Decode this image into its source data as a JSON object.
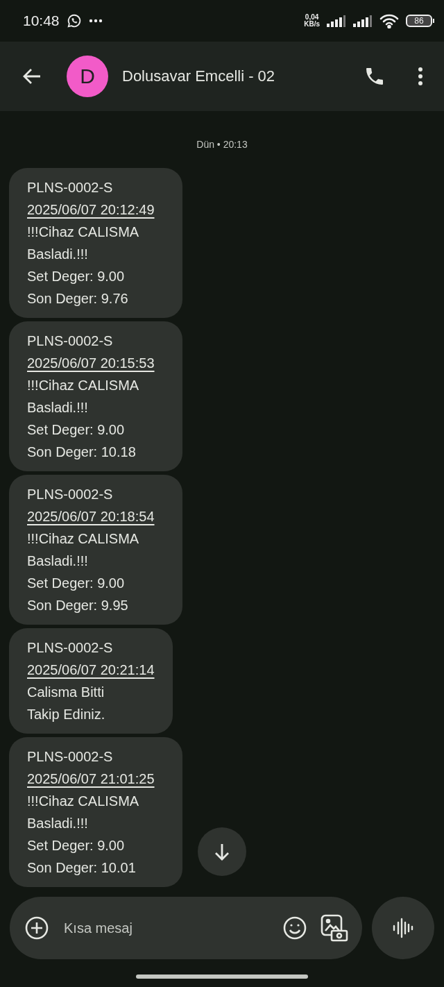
{
  "status_bar": {
    "time": "10:48",
    "speed_value": "0,04",
    "speed_unit": "KB/s",
    "battery": "86"
  },
  "header": {
    "avatar_letter": "D",
    "title": "Dolusavar Emcelli - 02"
  },
  "date_label": "Dün • 20:13",
  "messages": [
    {
      "lines": [
        {
          "kind": "text",
          "text": "PLNS-0002-S"
        },
        {
          "kind": "link",
          "text": "2025/06/07 20:12:49"
        },
        {
          "kind": "text",
          "text": "!!!Cihaz CALISMA Basladi.!!!"
        },
        {
          "kind": "text",
          "text": "Set Deger: 9.00"
        },
        {
          "kind": "text",
          "text": "Son Deger: 9.76"
        }
      ]
    },
    {
      "lines": [
        {
          "kind": "text",
          "text": "PLNS-0002-S"
        },
        {
          "kind": "link",
          "text": "2025/06/07 20:15:53"
        },
        {
          "kind": "text",
          "text": "!!!Cihaz CALISMA Basladi.!!!"
        },
        {
          "kind": "text",
          "text": "Set Deger: 9.00"
        },
        {
          "kind": "text",
          "text": "Son Deger: 10.18"
        }
      ]
    },
    {
      "lines": [
        {
          "kind": "text",
          "text": "PLNS-0002-S"
        },
        {
          "kind": "link",
          "text": "2025/06/07 20:18:54"
        },
        {
          "kind": "text",
          "text": "!!!Cihaz CALISMA Basladi.!!!"
        },
        {
          "kind": "text",
          "text": "Set Deger: 9.00"
        },
        {
          "kind": "text",
          "text": "Son Deger: 9.95"
        }
      ]
    },
    {
      "lines": [
        {
          "kind": "text",
          "text": "PLNS-0002-S"
        },
        {
          "kind": "link",
          "text": "2025/06/07 20:21:14"
        },
        {
          "kind": "text",
          "text": "Calisma Bitti"
        },
        {
          "kind": "text",
          "text": "Takip Ediniz."
        }
      ]
    },
    {
      "lines": [
        {
          "kind": "text",
          "text": "PLNS-0002-S"
        },
        {
          "kind": "link",
          "text": "2025/06/07 21:01:25"
        },
        {
          "kind": "text",
          "text": "!!!Cihaz CALISMA Basladi.!!!"
        },
        {
          "kind": "text",
          "text": "Set Deger: 9.00"
        },
        {
          "kind": "text",
          "text": "Son Deger: 10.01"
        }
      ]
    }
  ],
  "composer": {
    "placeholder": "Kısa mesaj"
  }
}
